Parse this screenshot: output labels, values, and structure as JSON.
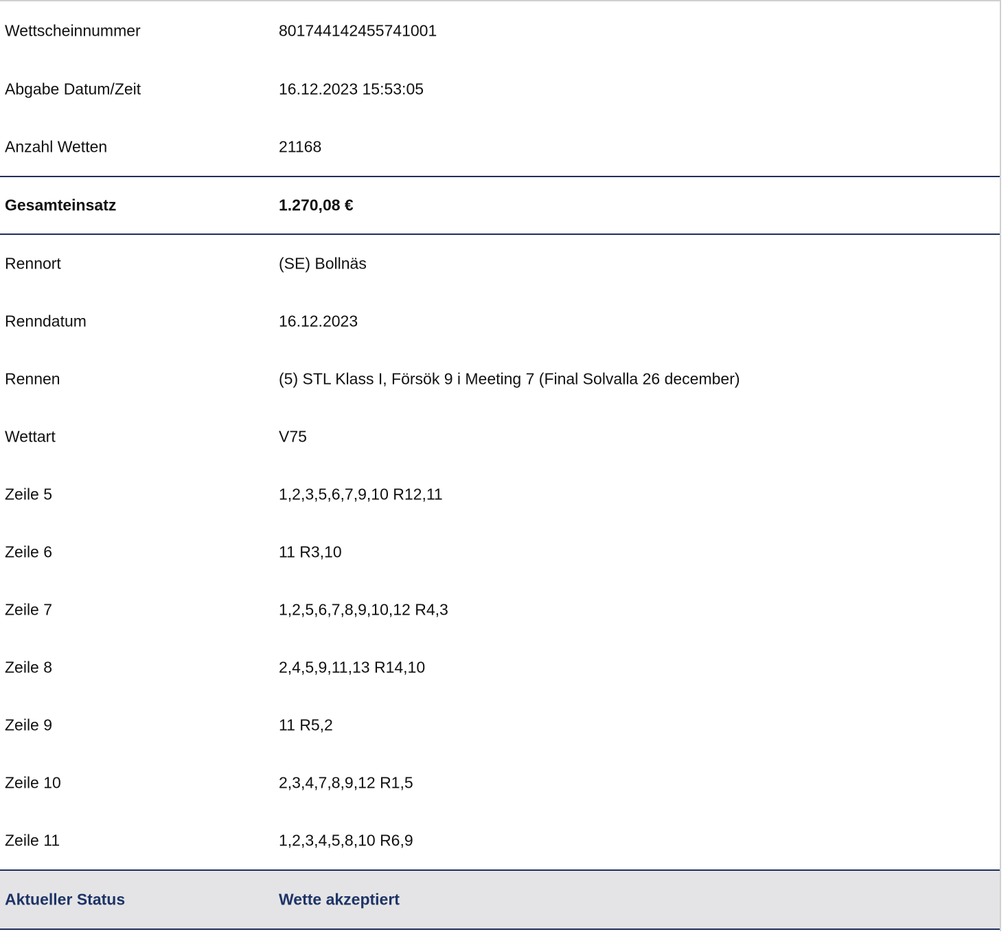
{
  "ticket": {
    "number_label": "Wettscheinnummer",
    "number_value": "801744142455741001",
    "submitted_label": "Abgabe Datum/Zeit",
    "submitted_value": "16.12.2023 15:53:05",
    "bets_count_label": "Anzahl Wetten",
    "bets_count_value": "21168",
    "total_label": "Gesamteinsatz",
    "total_value": "1.270,08 €",
    "venue_label": "Rennort",
    "venue_value": "(SE) Bollnäs",
    "race_date_label": "Renndatum",
    "race_date_value": "16.12.2023",
    "race_label": "Rennen",
    "race_value": "(5) STL Klass I, Försök 9 i Meeting 7 (Final Solvalla 26 december)",
    "bet_type_label": "Wettart",
    "bet_type_value": "V75",
    "lines": [
      {
        "label": "Zeile 5",
        "value": "1,2,3,5,6,7,9,10 R12,11"
      },
      {
        "label": "Zeile 6",
        "value": "11 R3,10"
      },
      {
        "label": "Zeile 7",
        "value": "1,2,5,6,7,8,9,10,12 R4,3"
      },
      {
        "label": "Zeile 8",
        "value": "2,4,5,9,11,13 R14,10"
      },
      {
        "label": "Zeile 9",
        "value": "11 R5,2"
      },
      {
        "label": "Zeile 10",
        "value": "2,3,4,7,8,9,12 R1,5"
      },
      {
        "label": "Zeile 11",
        "value": "1,2,3,4,5,8,10 R6,9"
      }
    ],
    "status_label": "Aktueller Status",
    "status_value": "Wette akzeptiert"
  },
  "colors": {
    "accent": "#1e3466",
    "divider": "#1e2f5c",
    "status_background": "#e4e4e6"
  }
}
